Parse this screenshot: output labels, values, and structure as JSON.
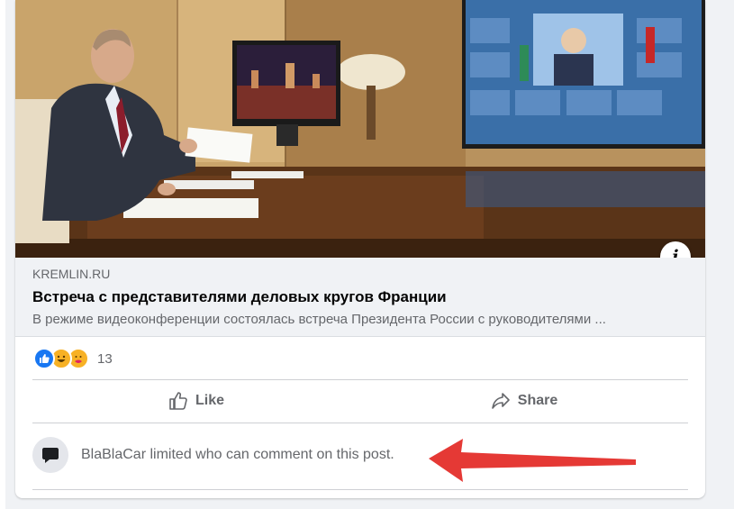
{
  "link_preview": {
    "domain": "KREMLIN.RU",
    "title": "Встреча с представителями деловых кругов Франции",
    "description": "В режиме видеоконференции состоялась встреча Президента России с руководителями ...",
    "image_alt": "Video conference meeting photo"
  },
  "reactions": {
    "types": [
      "like-icon",
      "haha-icon",
      "care-icon"
    ],
    "count": "13"
  },
  "actions": {
    "like_label": "Like",
    "share_label": "Share"
  },
  "comment_notice": {
    "text": "BlaBlaCar limited who can comment on this post."
  },
  "colors": {
    "facebook_blue": "#1877f2",
    "secondary_text": "#65676b",
    "annotation_arrow": "#e53935"
  }
}
